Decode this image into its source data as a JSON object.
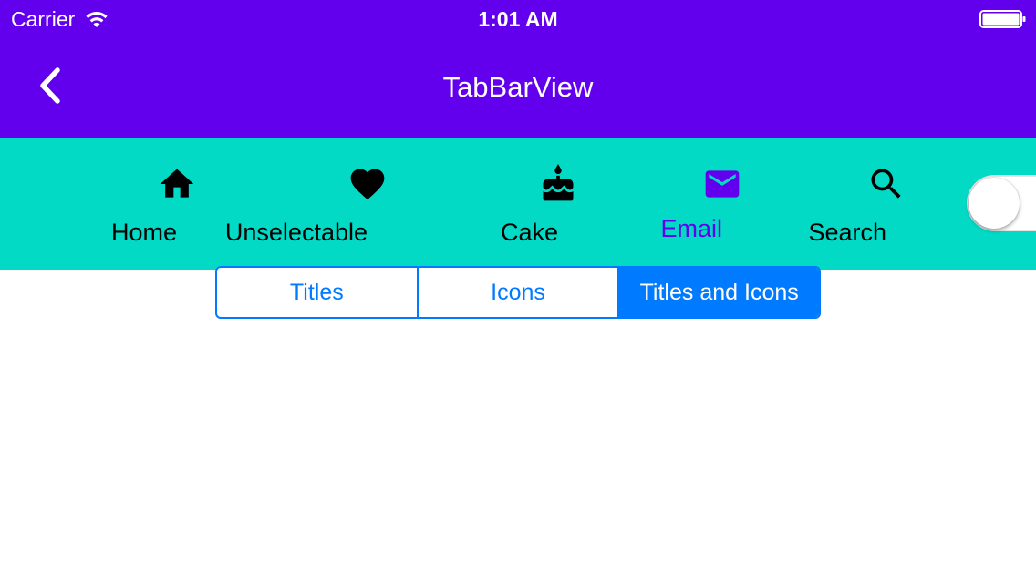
{
  "status_bar": {
    "carrier": "Carrier",
    "time": "1:01 AM",
    "wifi_icon": "wifi-icon",
    "battery_icon": "battery-icon"
  },
  "nav_bar": {
    "title": "TabBarView",
    "back_icon": "chevron-left-icon"
  },
  "tab_bar": {
    "background_color": "#03DAC6",
    "selected_color": "#6200EE",
    "tabs": [
      {
        "label": "Home",
        "icon": "home-icon",
        "selected": false
      },
      {
        "label": "Unselectable",
        "icon": "heart-icon",
        "selected": false
      },
      {
        "label": "Cake",
        "icon": "cake-icon",
        "selected": false
      },
      {
        "label": "Email",
        "icon": "email-icon",
        "selected": true
      },
      {
        "label": "Search",
        "icon": "search-icon",
        "selected": false
      }
    ]
  },
  "toggle": {
    "on": false
  },
  "segmented_control": {
    "accent_color": "#007AFF",
    "selected_index": 2,
    "segments": [
      "Titles",
      "Icons",
      "Titles and Icons"
    ]
  },
  "colors": {
    "header": "#6200EE",
    "header_text": "#FFFFFF",
    "body": "#FFFFFF"
  }
}
